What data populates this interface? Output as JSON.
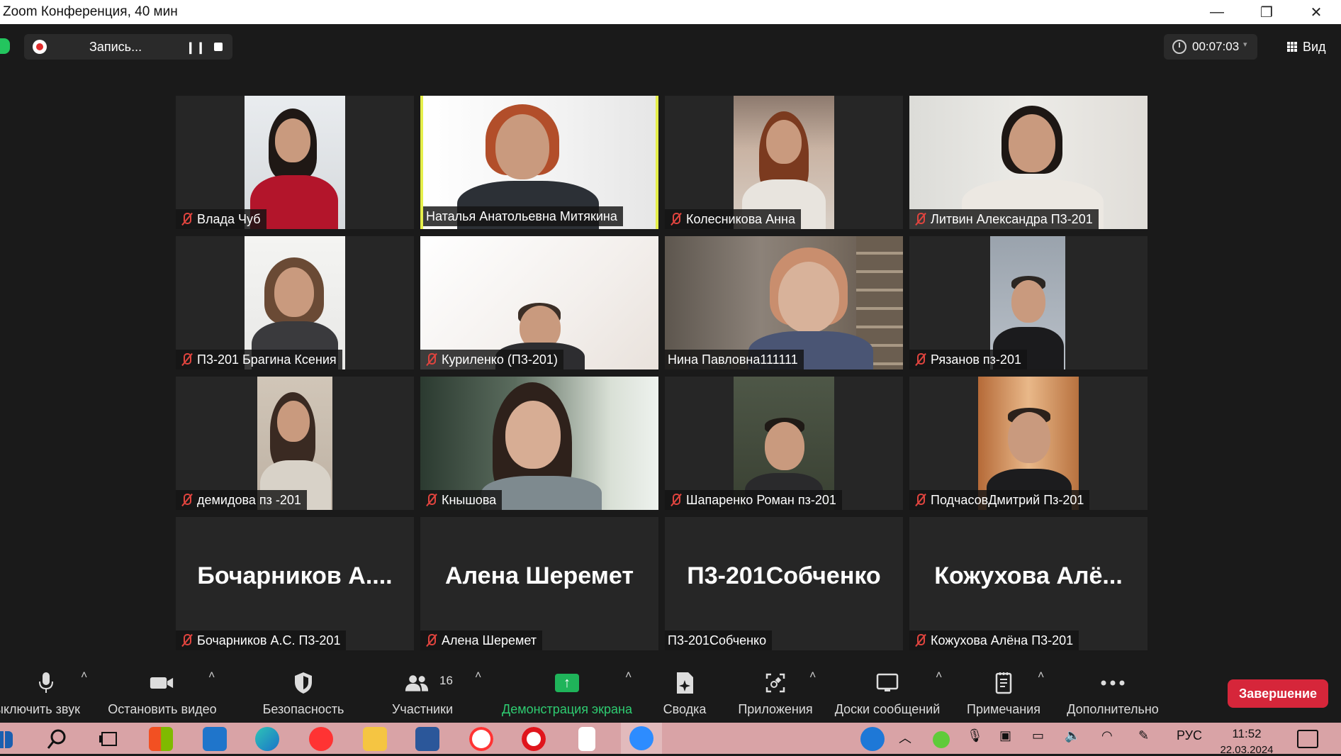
{
  "window": {
    "title": "Zoom Конференция, 40 мин",
    "minimize": "—",
    "restore": "❐",
    "close": "✕"
  },
  "topbar": {
    "recording_label": "Запись...",
    "pause_icon": "❙❙",
    "timer": "00:07:03",
    "timer_caret": "▾",
    "view_label": "Вид"
  },
  "participants": [
    {
      "name": "Влада Чуб",
      "muted": true
    },
    {
      "name": "Наталья Анатольевна Митякина",
      "muted": false,
      "active_speaker": true
    },
    {
      "name": "Колесникова Анна",
      "muted": true
    },
    {
      "name": "Литвин Александра П3-201",
      "muted": true
    },
    {
      "name": "П3-201 Брагина Ксения",
      "muted": true
    },
    {
      "name": "Куриленко (П3-201)",
      "muted": true
    },
    {
      "name": "Нина Павловна111111",
      "muted": false
    },
    {
      "name": "Рязанов пз-201",
      "muted": true
    },
    {
      "name": "демидова пз -201",
      "muted": true
    },
    {
      "name": "Кнышова",
      "muted": true
    },
    {
      "name": "Шапаренко Роман пз-201",
      "muted": true
    },
    {
      "name": "ПодчасовДмитрий Пз-201",
      "muted": true
    },
    {
      "name": "Бочарников А.С. П3-201",
      "big_name": "Бочарников А....",
      "muted": true,
      "video": false
    },
    {
      "name": "Алена Шеремет",
      "big_name": "Алена Шеремет",
      "muted": true,
      "video": false
    },
    {
      "name": "П3-201Собченко",
      "big_name": "П3-201Собченко",
      "muted": false,
      "video": false
    },
    {
      "name": "Кожухова Алёна П3-201",
      "big_name": "Кожухова Алё...",
      "muted": true,
      "video": false
    }
  ],
  "toolbar": {
    "mute": "ыключить звук",
    "video": "Остановить видео",
    "security": "Безопасность",
    "participants": "Участники",
    "participants_count": "16",
    "share": "Демонстрация экрана",
    "summary": "Сводка",
    "apps": "Приложения",
    "whiteboards": "Доски сообщений",
    "notes": "Примечания",
    "more": "Дополнительно",
    "end": "Завершение",
    "caret": "˄"
  },
  "taskbar": {
    "lang": "РУС",
    "time": "11:52",
    "date": "22.03.2024"
  }
}
